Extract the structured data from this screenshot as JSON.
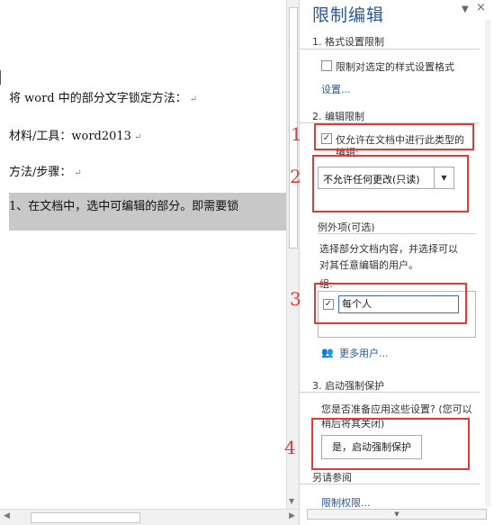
{
  "document": {
    "lines": [
      "将 word 中的部分文字锁定方法：",
      "材料/工具：word2013",
      "方法/步骤：",
      "1、在文档中，选中可编辑的部分。即需要锁"
    ],
    "paragraph_mark": "↵"
  },
  "pane": {
    "title": "限制编辑",
    "pin_icon": "chevron-down",
    "close_icon": "×",
    "section1": {
      "heading": "1. 格式设置限制",
      "checkbox_label": "限制对选定的样式设置格式",
      "settings_link": "设置..."
    },
    "section2": {
      "heading": "2. 编辑限制",
      "checkbox_label_line1": "仅允许在文档中进行此类型的",
      "checkbox_label_line2": "编辑:",
      "checked": true,
      "dropdown_value": "不允许任何更改(只读)",
      "exceptions_heading": "例外项(可选)",
      "exceptions_desc_line1": "选择部分文档内容，并选择可以",
      "exceptions_desc_line2": "对其任意编辑的用户。",
      "groups_label": "组:",
      "group_entry": "每个人",
      "group_checked": true,
      "more_users_link": "更多用户..."
    },
    "section3": {
      "heading": "3. 启动强制保护",
      "desc_line1": "您是否准备应用这些设置? (您可以",
      "desc_line2": "稍后将其关闭)",
      "start_button": "是，启动强制保护"
    },
    "see_also": {
      "heading": "另请参阅",
      "link": "限制权限..."
    }
  },
  "annotations": [
    "1",
    "2",
    "3",
    "4"
  ],
  "colors": {
    "accent": "#2b579a",
    "annotation": "#e53935",
    "selection": "#c8c8c8"
  }
}
